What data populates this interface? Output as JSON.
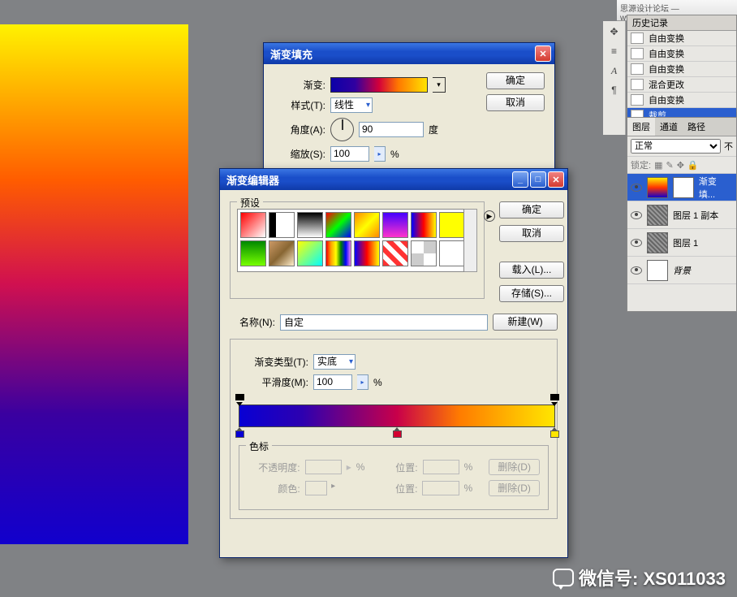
{
  "topbar_text": "思源设计论坛 — www.missyuan.com",
  "history": {
    "tab": "历史记录",
    "items": [
      {
        "label": "自由变换",
        "sel": false
      },
      {
        "label": "自由变换",
        "sel": false
      },
      {
        "label": "自由变换",
        "sel": false
      },
      {
        "label": "混合更改",
        "sel": false
      },
      {
        "label": "自由变换",
        "sel": false
      },
      {
        "label": "裁剪",
        "sel": true
      }
    ]
  },
  "layers": {
    "tabs": [
      "图层",
      "通道",
      "路径"
    ],
    "active_tab": 0,
    "blend_mode": "正常",
    "opacity_label": "不",
    "lock_label": "锁定:",
    "items": [
      {
        "name": "渐变填...",
        "thumb": "grad",
        "mask": true,
        "sel": true
      },
      {
        "name": "图层 1 副本",
        "thumb": "noise",
        "mask": false,
        "sel": false
      },
      {
        "name": "图层 1",
        "thumb": "noise",
        "mask": false,
        "sel": false
      },
      {
        "name": "背景",
        "thumb": "white",
        "mask": false,
        "sel": false,
        "italic": true
      }
    ]
  },
  "dlg_fill": {
    "title": "渐变填充",
    "ok": "确定",
    "cancel": "取消",
    "label_gradient": "渐变:",
    "label_style": "样式(T):",
    "style_value": "线性",
    "label_angle": "角度(A):",
    "angle_value": "90",
    "angle_unit": "度",
    "label_scale": "缩放(S):",
    "scale_value": "100",
    "scale_unit": "%"
  },
  "dlg_editor": {
    "title": "渐变编辑器",
    "presets_label": "预设",
    "ok": "确定",
    "cancel": "取消",
    "load": "载入(L)...",
    "save": "存储(S)...",
    "new": "新建(W)",
    "name_label": "名称(N):",
    "name_value": "自定",
    "type_label": "渐变类型(T):",
    "type_value": "实底",
    "smooth_label": "平滑度(M):",
    "smooth_value": "100",
    "smooth_unit": "%",
    "color_stops": [
      {
        "pos": 0,
        "color": "#0800d4"
      },
      {
        "pos": 50,
        "color": "#d4002f"
      },
      {
        "pos": 100,
        "color": "#ffe600"
      }
    ],
    "opacity_stops": [
      {
        "pos": 0
      },
      {
        "pos": 100
      }
    ],
    "swatch_label": "色标",
    "opacity_lbl": "不透明度:",
    "pos_lbl": "位置:",
    "pct": "%",
    "delete": "删除(D)",
    "color_lbl": "颜色:"
  },
  "presets": [
    "linear-gradient(135deg,#f00,#fff)",
    "linear-gradient(90deg,#000 0,#000 8px,transparent 8px,transparent 16px),#fff",
    "linear-gradient(#000,#fff)",
    "linear-gradient(135deg,#f00,#0f0,#00f)",
    "linear-gradient(135deg,#f80,#ff0,#f80)",
    "linear-gradient(#40f,#f3c)",
    "linear-gradient(90deg,#00f,#f00,#ff0)",
    "linear-gradient(#ff0,#ff0)",
    "linear-gradient(#080,#7f0)",
    "linear-gradient(135deg,#c96,#863,#fec)",
    "linear-gradient(135deg,#ff0,#0ff)",
    "linear-gradient(90deg,red,orange,yellow,green,blue,violet)",
    "linear-gradient(90deg,#00f,#f00,#ff0)",
    "repeating-linear-gradient(45deg,#f33 0 6px,#fff 6px 12px)",
    "repeating-conic-gradient(#ccc 0 25%,#fff 0 50%)",
    "#fff"
  ],
  "watermark": "微信号: XS011033"
}
